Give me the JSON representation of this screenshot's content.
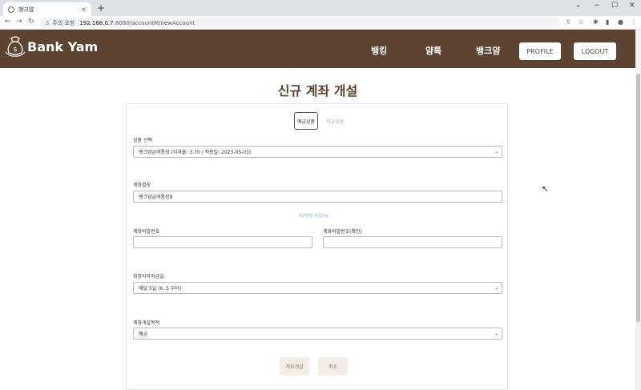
{
  "browser": {
    "tab_title": "뱅크얌",
    "tab_close": "×",
    "new_tab": "+",
    "warning_text": "주의 요함",
    "url_host": "192.168.0.7",
    "url_path": ":8080/accountM/newAccount",
    "window_controls": [
      "⌄",
      "−",
      "☐",
      "✕"
    ]
  },
  "header": {
    "logo_text": "Bank Yam",
    "nav": [
      "뱅킹",
      "얌톡",
      "뱅크얌"
    ],
    "profile_label": "PROFILE",
    "logout_label": "LOGOUT"
  },
  "page": {
    "title": "신규 계좌 개설"
  },
  "form": {
    "tabs": {
      "deposit": "예금상품",
      "savings": "적금상품"
    },
    "product_label": "상품 선택",
    "product_value": "뱅크얌급여통장 (이자율: 3.70 / 적용일: 2023-05-03)",
    "alias_label": "계좌별칭",
    "alias_value": "뱅크얌급여통장9",
    "alias_hint": "계좌별칭 변경가능",
    "password_label": "계좌비밀번호",
    "password_confirm_label": "계좌비밀번호(확인)",
    "interest_day_label": "희망이자지급일",
    "interest_day_value": "매달 5일 (6. 5 부터)",
    "purpose_label": "계좌개설목적",
    "purpose_value": "예금",
    "submit_label": "계좌개설",
    "cancel_label": "취소"
  },
  "colors": {
    "brand": "#5b4532",
    "button_bg": "#f3ede6"
  }
}
